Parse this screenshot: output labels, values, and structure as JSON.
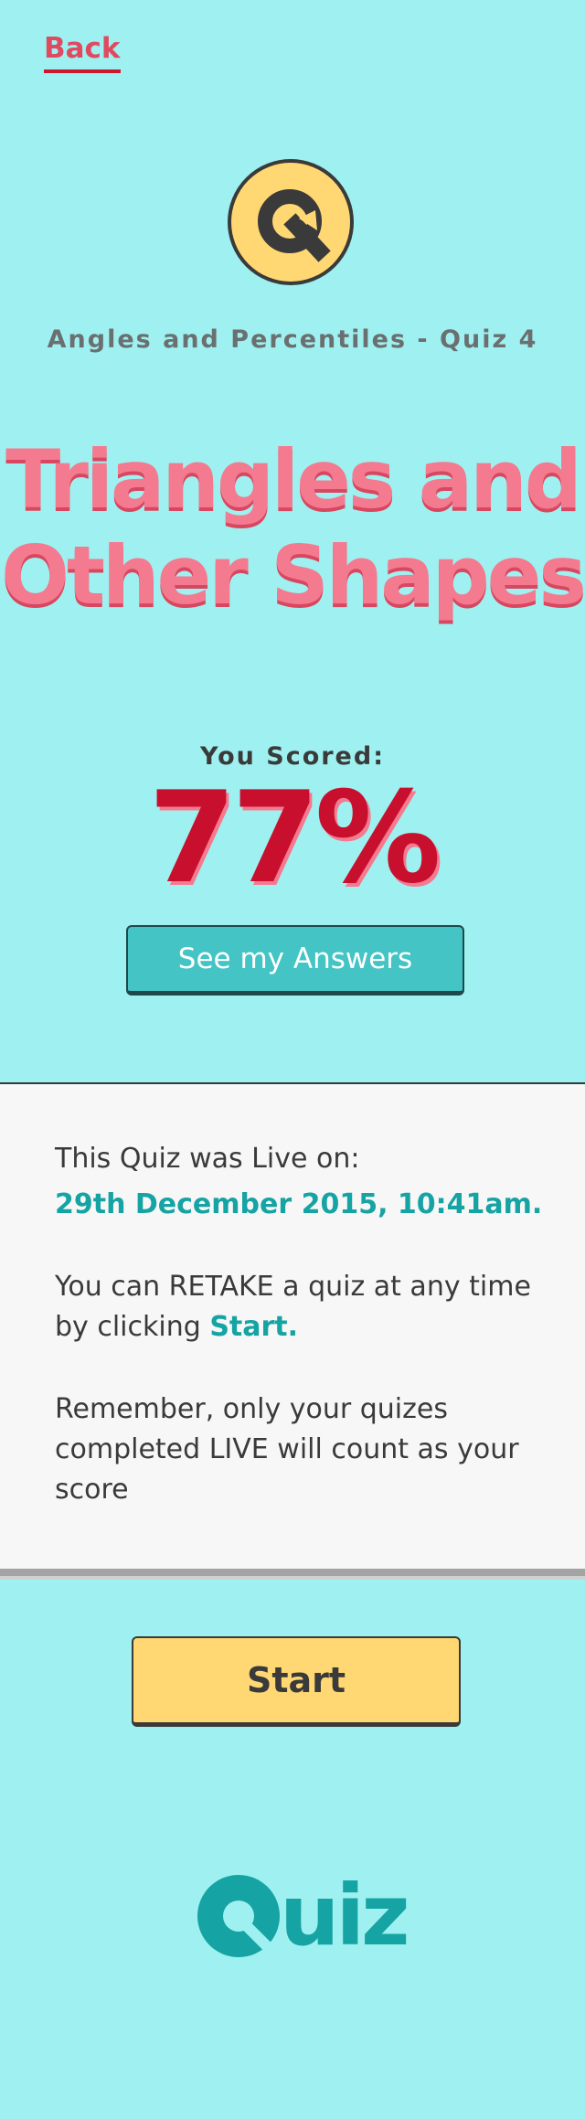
{
  "nav": {
    "back_label": "Back"
  },
  "quiz": {
    "subtitle": "Angles and Percentiles - Quiz 4",
    "title_line1": "Triangles and",
    "title_line2": "Other Shapes",
    "scored_label": "You Scored:",
    "score": "77%",
    "answers_button_label": "See my Answers"
  },
  "info": {
    "live_label": "This Quiz was Live on:",
    "live_date": "29th December 2015, 10:41am.",
    "retake_text": "You can RETAKE a quiz at any time by clicking",
    "retake_start": "Start.",
    "remember_text": "Remember, only your quizes completed LIVE will count as your score"
  },
  "actions": {
    "start_label": "Start"
  },
  "footer": {
    "logo_text": "uiz"
  },
  "colors": {
    "background": "#9ef1f0",
    "accent_teal": "#16a3a3",
    "accent_pink": "#f47a90",
    "score_red": "#c8102e",
    "start_yellow": "#ffd873",
    "button_teal": "#44c4c4"
  },
  "icons": {
    "header_logo": "quiz-logo-icon",
    "footer_logo": "quiz-q-icon"
  }
}
